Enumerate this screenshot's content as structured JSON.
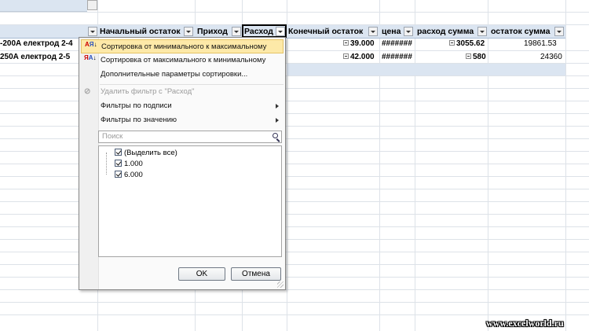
{
  "pivot": {
    "headers": [
      {
        "key": "opening",
        "label": "Начальный остаток"
      },
      {
        "key": "income",
        "label": "Приход"
      },
      {
        "key": "expense",
        "label": "Расход"
      },
      {
        "key": "closing",
        "label": "Конечный остаток"
      },
      {
        "key": "price",
        "label": "цена"
      },
      {
        "key": "expense_sum",
        "label": "расход сумма"
      },
      {
        "key": "balance_sum",
        "label": "остаток сумма"
      }
    ],
    "rows": [
      {
        "item": "-200A електрод 2-4",
        "closing": "39.000",
        "price": "#######",
        "expense_sum": "3055.62",
        "balance_sum": "19861.53"
      },
      {
        "item": "250A електрод 2-5",
        "closing": "42.000",
        "price": "#######",
        "expense_sum": "580",
        "balance_sum": "24360"
      }
    ]
  },
  "filter_menu": {
    "sort_asc": "Сортировка от минимального к максимальному",
    "sort_desc": "Сортировка от максимального к минимальному",
    "more_sort": "Дополнительные параметры сортировки...",
    "clear_filter": "Удалить фильтр с \"Расход\"",
    "label_filters": "Фильтры по подписи",
    "value_filters": "Фильтры по значению",
    "search_placeholder": "Поиск",
    "items": [
      "(Выделить все)",
      "1.000",
      "6.000"
    ],
    "ok": "OK",
    "cancel": "Отмена"
  },
  "watermark": "www.excelworld.ru",
  "colors": {
    "header_band": "#dbe5f1",
    "menu_highlight": "#fde9a8"
  }
}
